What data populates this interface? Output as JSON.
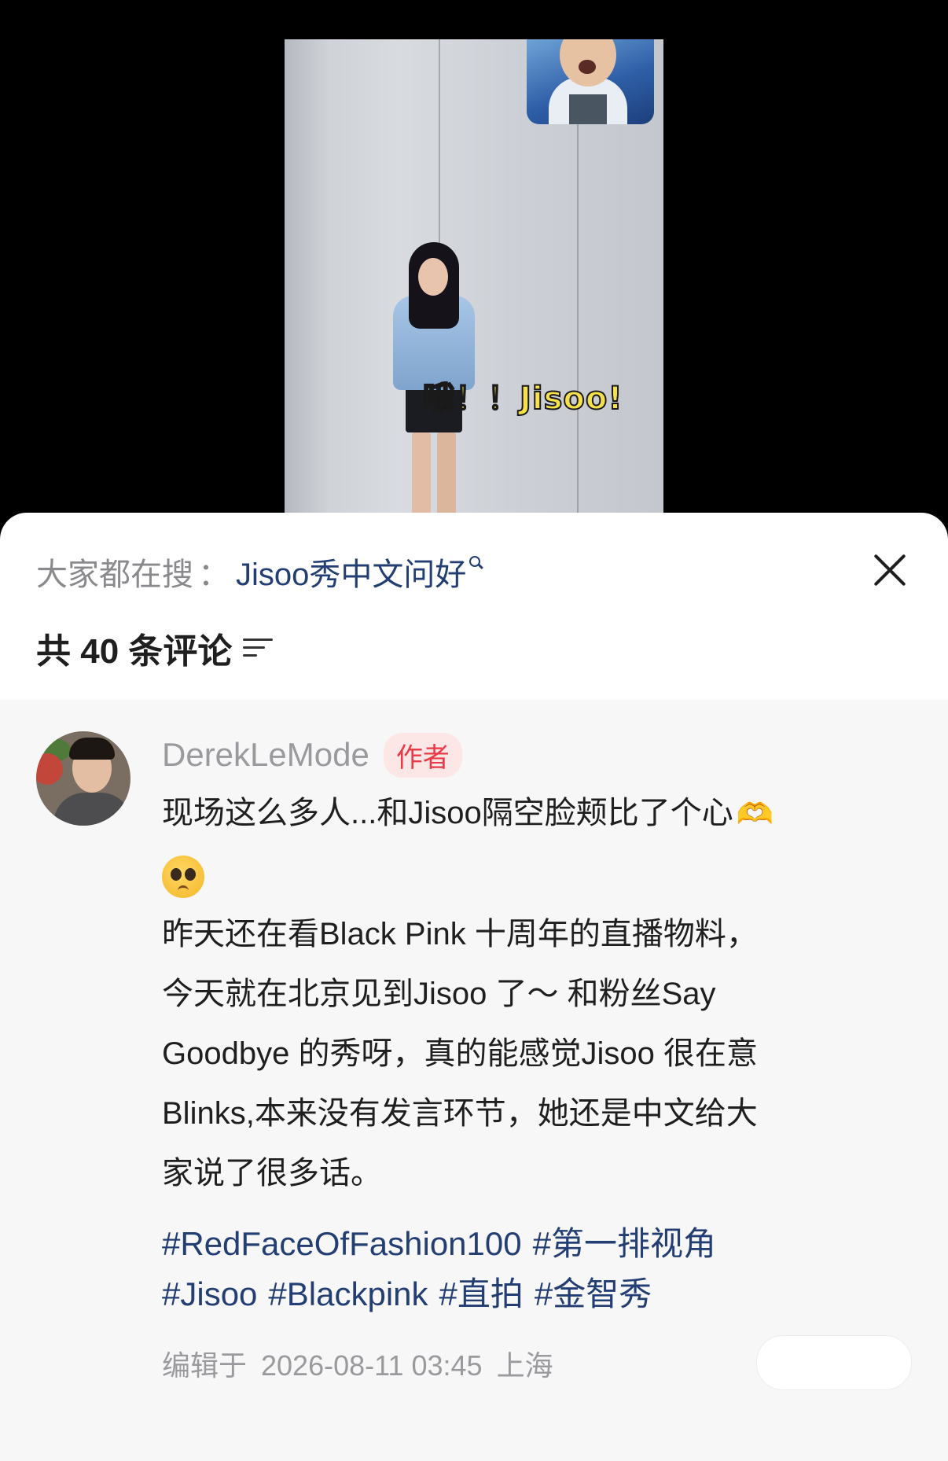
{
  "video": {
    "caption": "哦！！Jisoo!"
  },
  "search_bar": {
    "prefix": "大家都在搜",
    "colon": "：",
    "term": "Jisoo秀中文问好"
  },
  "comments_header": {
    "count_label": "共 40 条评论"
  },
  "comment": {
    "author": "DerekLeMode",
    "badge": "作者",
    "lines": [
      "现场这么多人...和Jisoo隔空脸颊比了个心",
      "昨天还在看Black Pink 十周年的直播物料，",
      "今天就在北京见到Jisoo 了～ 和粉丝Say",
      "Goodbye 的秀呀，真的能感觉Jisoo 很在意",
      "Blinks,本来没有发言环节，她还是中文给大",
      "家说了很多话。"
    ],
    "emoji_hands": "🫶",
    "emoji_face_name": "pleading-face",
    "tags_line1": [
      "#RedFaceOfFashion100",
      "#第一排视角"
    ],
    "tags_line2": [
      "#Jisoo",
      "#Blackpink",
      "#直拍",
      "#金智秀"
    ],
    "edited_label": "编辑于",
    "edited_time": "2026-08-11 03:45",
    "location": "上海"
  },
  "colors": {
    "link": "#233e72",
    "badge_text": "#e83a47",
    "badge_bg": "#fde6e6",
    "muted_text": "#9a9a9e",
    "card_bg": "#f7f7f7"
  },
  "icons": {
    "close": "close-icon",
    "search": "search-icon",
    "sort": "sort-icon"
  }
}
